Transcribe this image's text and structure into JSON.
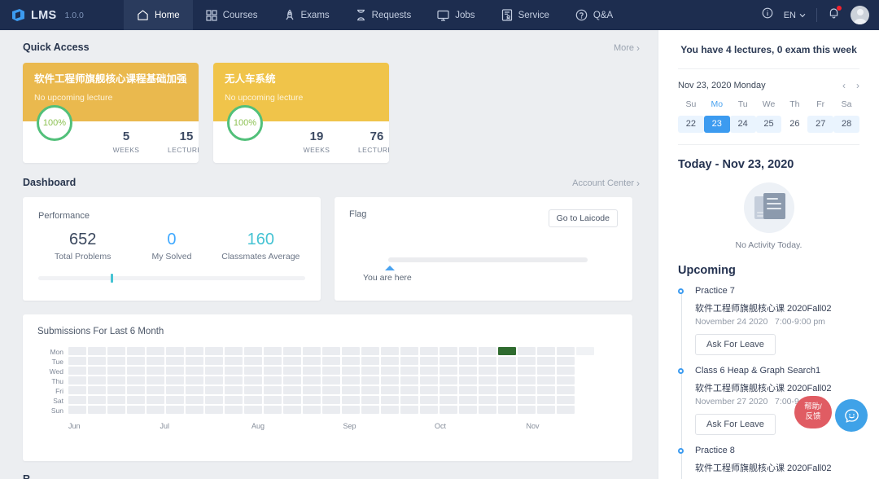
{
  "topnav": {
    "brand": "LMS",
    "version": "1.0.0",
    "items": [
      {
        "label": "Home",
        "icon": "home-icon",
        "active": true
      },
      {
        "label": "Courses",
        "icon": "grid-icon",
        "active": false
      },
      {
        "label": "Exams",
        "icon": "rocket-icon",
        "active": false
      },
      {
        "label": "Requests",
        "icon": "hourglass-icon",
        "active": false
      },
      {
        "label": "Jobs",
        "icon": "monitor-icon",
        "active": false
      },
      {
        "label": "Service",
        "icon": "contact-card-icon",
        "active": false
      },
      {
        "label": "Q&A",
        "icon": "question-circle-icon",
        "active": false
      }
    ],
    "info_icon": "info-circle-icon",
    "language": "EN",
    "language_chevron": "∨",
    "bell_icon": "bell-icon",
    "has_notification": true,
    "avatar_icon": "user-avatar"
  },
  "quick_access": {
    "title": "Quick Access",
    "more_label": "More",
    "chevron": "›",
    "cards": [
      {
        "title": "软件工程师旗舰核心课程基础加强",
        "subtitle": "No upcoming lecture",
        "progress": "100%",
        "header_color": "#eab94e",
        "stats": [
          {
            "value": "5",
            "label": "WEEKS"
          },
          {
            "value": "15",
            "label": "LECTURES"
          }
        ]
      },
      {
        "title": "无人车系统",
        "subtitle": "No upcoming lecture",
        "progress": "100%",
        "header_color": "#f0c44a",
        "stats": [
          {
            "value": "19",
            "label": "WEEKS"
          },
          {
            "value": "76",
            "label": "LECTURES"
          }
        ]
      }
    ]
  },
  "dashboard": {
    "title": "Dashboard",
    "account_center_label": "Account Center",
    "chevron": "›",
    "performance": {
      "label": "Performance",
      "stats": [
        {
          "value": "652",
          "label": "Total Problems",
          "color": "#3b485e"
        },
        {
          "value": "0",
          "label": "My Solved",
          "color": "#40a9ff"
        },
        {
          "value": "160",
          "label": "Classmates Average",
          "color": "#45c3d3"
        }
      ],
      "slider_position_pct": 27
    },
    "flag": {
      "label": "Flag",
      "button_label": "Go to Laicode",
      "marker_label": "You are here"
    }
  },
  "chart_data": {
    "type": "heatmap",
    "title": "Submissions For Last 6 Month",
    "ylabel": "",
    "xlabel": "",
    "day_labels": [
      "Mon",
      "Tue",
      "Wed",
      "Thu",
      "Fri",
      "Sat",
      "Sun"
    ],
    "month_labels": [
      "Jun",
      "Jul",
      "Aug",
      "Sep",
      "Oct",
      "Nov"
    ],
    "weeks": 27,
    "empty_color": "#eaecf0",
    "active_color": "#2f6b2f",
    "active_cells": [
      {
        "week": 22,
        "day": 0,
        "value": 1
      }
    ],
    "note": "All cells are zero-submission grey except one dark-green Monday cell in the Nov column."
  },
  "bottom_section": {
    "title": "R"
  },
  "sidebar": {
    "week_summary": "You have 4 lectures, 0 exam this week",
    "calendar": {
      "current_date": "Nov 23, 2020 Monday",
      "prev_icon": "‹",
      "next_icon": "›",
      "dow": [
        "Su",
        "Mo",
        "Tu",
        "We",
        "Th",
        "Fr",
        "Sa"
      ],
      "highlight_dow": "Mo",
      "days": [
        {
          "n": "22",
          "state": "soft"
        },
        {
          "n": "23",
          "state": "selected"
        },
        {
          "n": "24",
          "state": "soft"
        },
        {
          "n": "25",
          "state": "soft"
        },
        {
          "n": "26",
          "state": "plain"
        },
        {
          "n": "27",
          "state": "soft"
        },
        {
          "n": "28",
          "state": "soft"
        }
      ]
    },
    "today": {
      "title": "Today - Nov 23, 2020",
      "empty_icon": "document-stack-icon",
      "empty_text": "No Activity Today."
    },
    "upcoming": {
      "title": "Upcoming",
      "items": [
        {
          "name": "Practice 7",
          "course": "软件工程师旗舰核心课 2020Fall02",
          "when": "November 24 2020   7:00-9:00 pm",
          "button_label": "Ask For Leave"
        },
        {
          "name": "Class 6 Heap & Graph Search1",
          "course": "软件工程师旗舰核心课 2020Fall02",
          "when": "November 27 2020   7:00-9:00 pm",
          "button_label": "Ask For Leave"
        },
        {
          "name": "Practice 8",
          "course": "软件工程师旗舰核心课 2020Fall02",
          "when": "",
          "button_label": ""
        }
      ]
    }
  },
  "help_widget": {
    "line1": "帮助/",
    "line2": "反馈",
    "icon": "chat-smiley-icon",
    "pill_color": "#e05c63",
    "circle_color": "#3fa2e8"
  }
}
